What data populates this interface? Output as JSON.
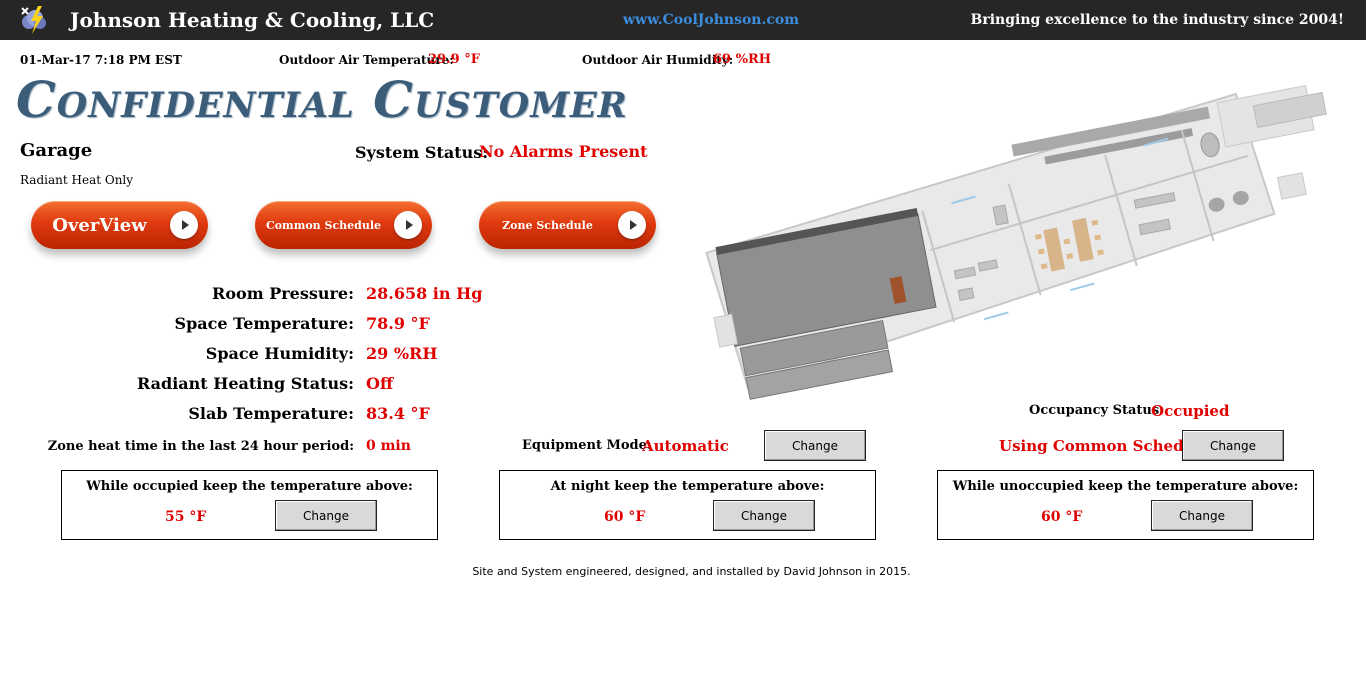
{
  "header": {
    "company": "Johnson Heating & Cooling, LLC",
    "website": "www.CoolJohnson.com",
    "tagline": "Bringing excellence to the industry since 2004!"
  },
  "conditions": {
    "datetime": "01-Mar-17 7:18 PM EST",
    "outdoor_temp_label": "Outdoor Air Temperature:",
    "outdoor_temp_value": "29.9 °F",
    "outdoor_humidity_label": "Outdoor Air Humidity:",
    "outdoor_humidity_value": "69 %RH"
  },
  "customer_title": "Confidential Customer",
  "zone": {
    "name": "Garage",
    "subtitle": "Radiant Heat Only",
    "system_status_label": "System Status:",
    "system_status_value": "No Alarms Present"
  },
  "nav": {
    "overview": "OverView",
    "common_schedule": "Common Schedule",
    "zone_schedule": "Zone Schedule"
  },
  "readings": [
    {
      "label": "Room Pressure:",
      "value": "28.658 in Hg"
    },
    {
      "label": "Space Temperature:",
      "value": "78.9 °F"
    },
    {
      "label": "Space Humidity:",
      "value": "29 %RH"
    },
    {
      "label": "Radiant Heating Status:",
      "value": "Off"
    },
    {
      "label": "Slab Temperature:",
      "value": "83.4 °F"
    }
  ],
  "zone_heat": {
    "label": "Zone heat time in the last 24 hour period:",
    "value": "0 min"
  },
  "equipment": {
    "label": "Equipment Mode:",
    "value": "Automatic",
    "button": "Change"
  },
  "occupancy": {
    "label": "Occupancy Status:",
    "value": "Occupied"
  },
  "schedule": {
    "value": "Using Common Schedule",
    "button": "Change"
  },
  "setpoints": [
    {
      "title": "While occupied keep the temperature above:",
      "value": "55 °F",
      "button": "Change"
    },
    {
      "title": "At night keep the temperature above:",
      "value": "60 °F",
      "button": "Change"
    },
    {
      "title": "While unoccupied keep the temperature above:",
      "value": "60 °F",
      "button": "Change"
    }
  ],
  "footer": "Site and System engineered, designed, and installed by David Johnson in 2015.",
  "colors": {
    "accent": "#e00000",
    "title": "#3b5d7a",
    "header_bg": "#262626",
    "link": "#3c8dde",
    "button_orange": "#e03a10"
  }
}
